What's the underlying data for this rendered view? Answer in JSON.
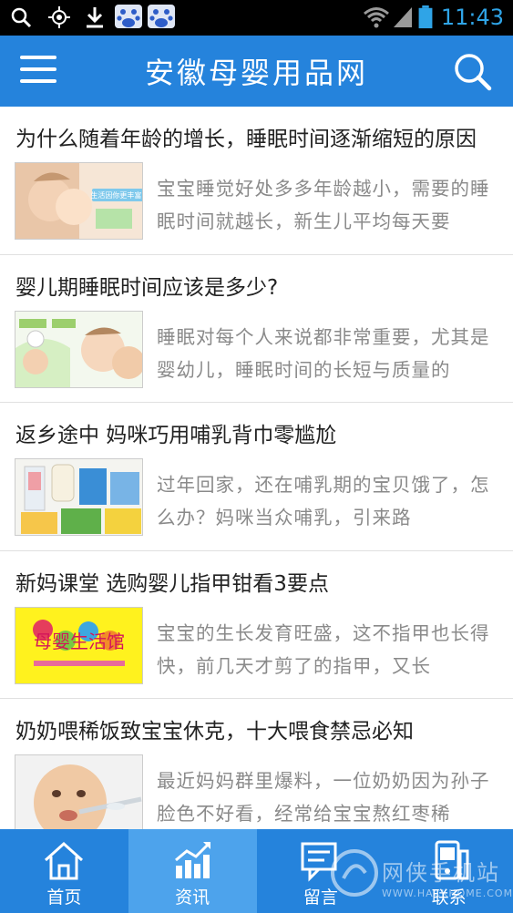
{
  "status_bar": {
    "time": "11:43",
    "icons": [
      "search-icon",
      "gps-icon",
      "download-icon",
      "baidu-icon",
      "baidu-icon",
      "wifi-icon",
      "signal-icon",
      "battery-icon"
    ]
  },
  "header": {
    "title": "安徽母婴用品网",
    "menu_icon": "menu-icon",
    "search_icon": "search-icon",
    "color": "#2583dc"
  },
  "articles": [
    {
      "title": "为什么随着年龄的增长，睡眠时间逐渐缩短的原因",
      "summary": "宝宝睡觉好处多多年龄越小，需要的睡眠时间就越长，新生儿平均每天要",
      "thumb_caption": "生活因你更丰富!"
    },
    {
      "title": "婴儿期睡眠时间应该是多少?",
      "summary": "睡眠对每个人来说都非常重要，尤其是婴幼儿，睡眠时间的长短与质量的",
      "thumb_caption": ""
    },
    {
      "title": "返乡途中 妈咪巧用哺乳背巾零尴尬",
      "summary": "过年回家，还在哺乳期的宝贝饿了，怎么办？妈咪当众哺乳，引来路",
      "thumb_caption": ""
    },
    {
      "title": "新妈课堂 选购婴儿指甲钳看3要点",
      "summary": "宝宝的生长发育旺盛，这不指甲也长得快，前几天才剪了的指甲，又长",
      "thumb_caption": "母婴生活馆"
    },
    {
      "title": "奶奶喂稀饭致宝宝休克，十大喂食禁忌必知",
      "summary": "最近妈妈群里爆料，一位奶奶因为孙子脸色不好看，经常给宝宝熬红枣稀",
      "thumb_caption": ""
    }
  ],
  "bottom_nav": [
    {
      "label": "首页",
      "icon": "home-icon",
      "active": false
    },
    {
      "label": "资讯",
      "icon": "chart-icon",
      "active": true
    },
    {
      "label": "留言",
      "icon": "message-icon",
      "active": false
    },
    {
      "label": "联系",
      "icon": "phone-icon",
      "active": false
    }
  ],
  "watermark": {
    "text": "网侠手机站",
    "url": "WWW.HACKHOME.COM"
  }
}
